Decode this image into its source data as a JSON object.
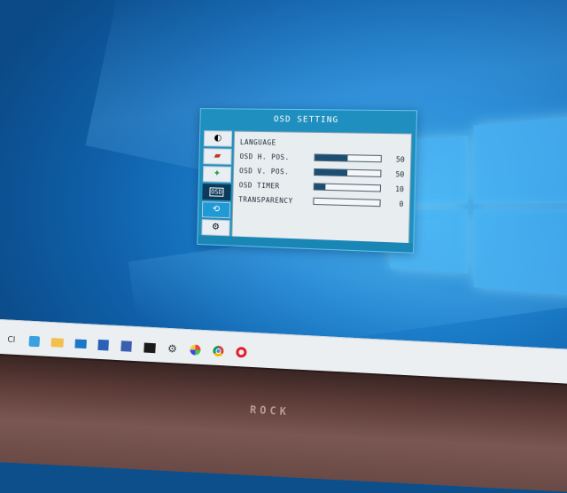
{
  "osd": {
    "title": "OSD SETTING",
    "tabs": [
      {
        "name": "brightness-contrast-icon",
        "glyph": "◐"
      },
      {
        "name": "image-adjust-icon",
        "glyph": "▰"
      },
      {
        "name": "color-icon",
        "glyph": "✦"
      },
      {
        "name": "osd-setting-icon",
        "glyph": "OSD",
        "active": true
      },
      {
        "name": "reset-icon",
        "glyph": "⟲"
      },
      {
        "name": "misc-settings-icon",
        "glyph": "⚙"
      }
    ],
    "rows": [
      {
        "label": "LANGUAGE",
        "value": null,
        "level": null
      },
      {
        "label": "OSD H. POS.",
        "value": "50",
        "level": 0.5
      },
      {
        "label": "OSD V. POS.",
        "value": "50",
        "level": 0.5
      },
      {
        "label": "OSD TIMER",
        "value": "10",
        "level": 0.17
      },
      {
        "label": "TRANSPARENCY",
        "value": "0",
        "level": 0.0
      }
    ]
  },
  "taskbar": {
    "ime_label": "CI",
    "icons": [
      "task-view-icon",
      "file-explorer-icon",
      "mail-icon",
      "word-icon",
      "app-icon",
      "terminal-icon",
      "settings-icon",
      "paint-icon",
      "chrome-icon",
      "opera-icon"
    ]
  },
  "monitor": {
    "brand": "ROCK"
  },
  "colors": {
    "osd_bg": "#1f8fc0",
    "panel_bg": "#e8edf0",
    "bar_fill": "#1b4e73",
    "desktop_blue": "#1d82cf"
  }
}
